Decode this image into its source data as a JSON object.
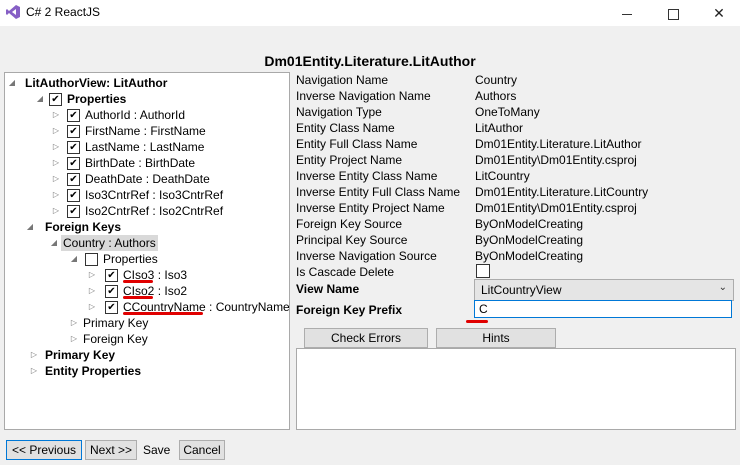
{
  "window": {
    "title": "C# 2 ReactJS"
  },
  "heading": "Dm01Entity.Literature.LitAuthor",
  "tree": {
    "root": "LitAuthorView: LitAuthor",
    "properties_group": "Properties",
    "properties": [
      "AuthorId : AuthorId",
      "FirstName : FirstName",
      "LastName : LastName",
      "BirthDate : BirthDate",
      "DeathDate : DeathDate",
      "Iso3CntrRef : Iso3CntrRef",
      "Iso2CntrRef : Iso2CntrRef"
    ],
    "foreign_keys": "Foreign Keys",
    "fk_node": "Country : Authors",
    "fk_properties_group": "Properties",
    "fk_properties": [
      {
        "name": "CIso3",
        "type": " : Iso3"
      },
      {
        "name": "CIso2",
        "type": " : Iso2"
      },
      {
        "name": "CCountryName",
        "type": " : CountryName"
      }
    ],
    "fk_primary_key": "Primary Key",
    "fk_foreign_key": "Foreign Key",
    "primary_key": "Primary Key",
    "entity_properties": "Entity Properties"
  },
  "details": [
    {
      "label": "Navigation Name",
      "value": "Country"
    },
    {
      "label": "Inverse Navigation Name",
      "value": "Authors"
    },
    {
      "label": "Navigation Type",
      "value": "OneToMany"
    },
    {
      "label": "Entity Class Name",
      "value": "LitAuthor"
    },
    {
      "label": "Entity Full Class Name",
      "value": "Dm01Entity.Literature.LitAuthor"
    },
    {
      "label": "Entity Project Name",
      "value": "Dm01Entity\\Dm01Entity.csproj"
    },
    {
      "label": "Inverse Entity Class Name",
      "value": "LitCountry"
    },
    {
      "label": "Inverse Entity Full Class Name",
      "value": "Dm01Entity.Literature.LitCountry"
    },
    {
      "label": "Inverse Entity Project Name",
      "value": "Dm01Entity\\Dm01Entity.csproj"
    },
    {
      "label": "Foreign Key Source",
      "value": "ByOnModelCreating"
    },
    {
      "label": "Principal Key Source",
      "value": "ByOnModelCreating"
    },
    {
      "label": "Inverse Navigation Source",
      "value": "ByOnModelCreating"
    }
  ],
  "cascade_delete_label": "Is Cascade Delete",
  "view_name": {
    "label": "View Name",
    "value": "LitCountryView"
  },
  "fk_prefix": {
    "label": "Foreign Key Prefix",
    "value": "C"
  },
  "buttons": {
    "check_errors": "Check Errors",
    "hints": "Hints",
    "previous": "<< Previous",
    "next": "Next >>",
    "save": "Save",
    "cancel": "Cancel"
  },
  "colors": {
    "accent": "#0078d7",
    "annotation": "#e00000"
  }
}
